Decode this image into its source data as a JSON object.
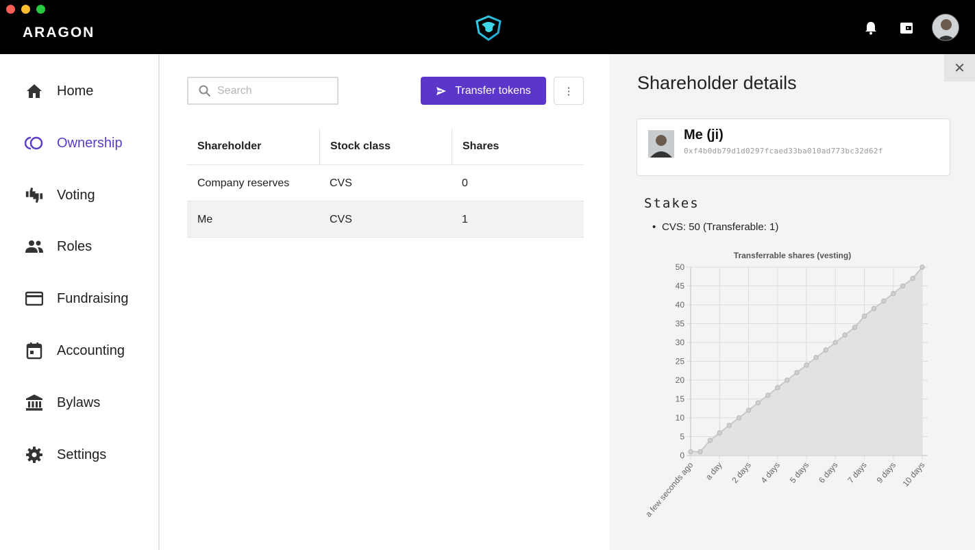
{
  "window": {
    "traffic_lights": [
      "#fd5f57",
      "#febc2e",
      "#28c840"
    ],
    "brand": "ARAGON",
    "center_logo": "aragon-eagle-logo",
    "icons": [
      "bell-icon",
      "wallet-icon"
    ],
    "avatar": "user-avatar"
  },
  "colors": {
    "accent": "#5b37c9",
    "topbar": "#000000",
    "panel_bg": "#f4f4f4",
    "chart_fill": "#dedede",
    "chart_line": "#c8c8c8"
  },
  "sidebar": {
    "items": [
      {
        "label": "Home",
        "icon": "home-icon",
        "active": false
      },
      {
        "label": "Ownership",
        "icon": "ownership-icon",
        "active": true
      },
      {
        "label": "Voting",
        "icon": "voting-icon",
        "active": false
      },
      {
        "label": "Roles",
        "icon": "roles-icon",
        "active": false
      },
      {
        "label": "Fundraising",
        "icon": "fundraising-icon",
        "active": false
      },
      {
        "label": "Accounting",
        "icon": "calendar-icon",
        "active": false
      },
      {
        "label": "Bylaws",
        "icon": "bylaws-icon",
        "active": false
      },
      {
        "label": "Settings",
        "icon": "gear-icon",
        "active": false
      }
    ]
  },
  "toolbar": {
    "search_placeholder": "Search",
    "transfer_label": "Transfer tokens",
    "more_label": "⋮"
  },
  "table": {
    "headers": [
      "Shareholder",
      "Stock class",
      "Shares"
    ],
    "rows": [
      {
        "shareholder": "Company reserves",
        "stock_class": "CVS",
        "shares": "0",
        "selected": false
      },
      {
        "shareholder": "Me",
        "stock_class": "CVS",
        "shares": "1",
        "selected": true
      }
    ]
  },
  "details": {
    "title": "Shareholder details",
    "close_label": "✕",
    "holder_name": "Me (ji)",
    "holder_address": "0xf4b0db79d1d0297fcaed33ba010ad773bc32d62f",
    "stakes_title": "Stakes",
    "stakes": [
      "CVS: 50 (Transferable: 1)"
    ]
  },
  "chart_data": {
    "type": "area",
    "title": "Transferrable shares (vesting)",
    "xlabel": "",
    "ylabel": "",
    "x_ticks": [
      "a few seconds ago",
      "a day",
      "2 days",
      "4 days",
      "5 days",
      "6 days",
      "7 days",
      "9 days",
      "10 days"
    ],
    "x_tick_days": [
      0,
      1,
      2,
      3,
      4,
      5,
      6,
      7,
      8
    ],
    "y_ticks": [
      0,
      5,
      10,
      15,
      20,
      25,
      30,
      35,
      40,
      45,
      50
    ],
    "ylim": [
      0,
      50
    ],
    "grid": true,
    "legend": "none",
    "series": [
      {
        "x": [
          0,
          0.33,
          0.67,
          1.0,
          1.33,
          1.67,
          2.0,
          2.33,
          2.67,
          3.0,
          3.33,
          3.67,
          4.0,
          4.33,
          4.67,
          5.0,
          5.33,
          5.67,
          6.0,
          6.33,
          6.67,
          7.0,
          7.33,
          7.67,
          8.0
        ],
        "y": [
          1,
          1,
          4,
          6,
          8,
          10,
          12,
          14,
          16,
          18,
          20,
          22,
          24,
          26,
          28,
          30,
          32,
          34,
          37,
          39,
          41,
          43,
          45,
          47,
          50
        ]
      }
    ]
  }
}
